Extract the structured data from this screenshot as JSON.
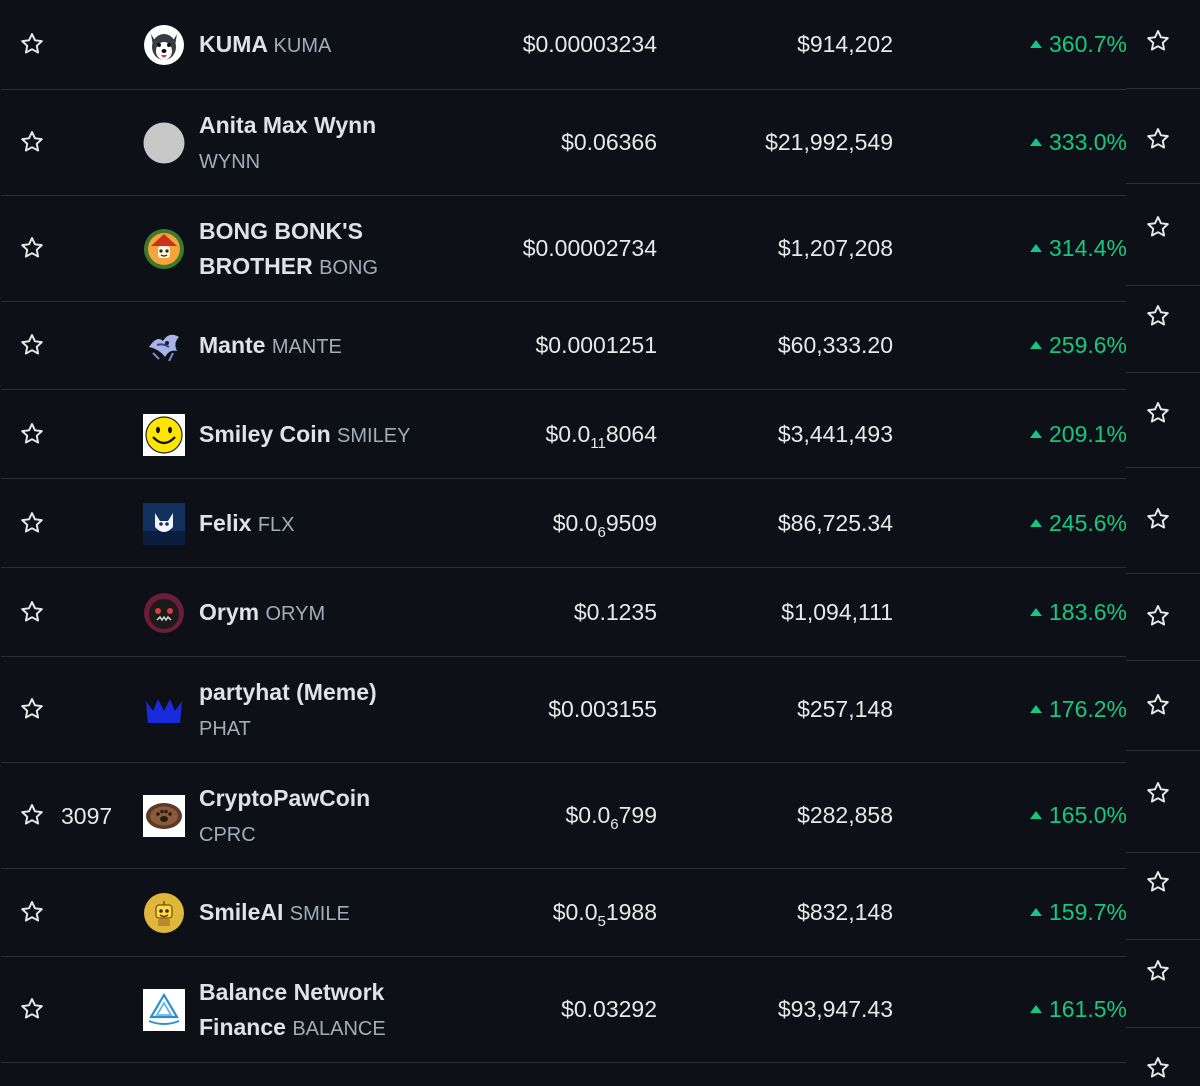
{
  "icons": {
    "favorite": "star-outline-icon",
    "trend": "caret-up-icon"
  },
  "colors": {
    "background": "#0d1117",
    "divider": "#2a2f37",
    "positive": "#16c784",
    "text": "#e6e8ea",
    "muted": "#a5acb8"
  },
  "rows": [
    {
      "rank": "",
      "name": "KUMA",
      "symbol": "KUMA",
      "symbol_inline": true,
      "price": "$0.00003234",
      "market_cap": "$914,202",
      "change": "360.7%",
      "logo": "husky-dog-logo"
    },
    {
      "rank": "",
      "name": "Anita Max Wynn",
      "symbol": "WYNN",
      "symbol_inline": false,
      "price": "$0.06366",
      "market_cap": "$21,992,549",
      "change": "333.0%",
      "logo": "grey-circle-logo"
    },
    {
      "rank": "",
      "name": "BONG BONK'S BROTHER",
      "symbol": "BONG",
      "symbol_inline": true,
      "price": "$0.00002734",
      "market_cap": "$1,207,208",
      "change": "314.4%",
      "logo": "bong-dog-logo"
    },
    {
      "rank": "",
      "name": "Mante",
      "symbol": "MANTE",
      "symbol_inline": true,
      "price": "$0.0001251",
      "market_cap": "$60,333.20",
      "change": "259.6%",
      "logo": "mante-creature-logo"
    },
    {
      "rank": "",
      "name": "Smiley Coin",
      "symbol": "SMILEY",
      "symbol_inline": true,
      "price_prefix": "$0.0",
      "price_sub": "11",
      "price_rest": "8064",
      "market_cap": "$3,441,493",
      "change": "209.1%",
      "logo": "smiley-face-logo"
    },
    {
      "rank": "",
      "name": "Felix",
      "symbol": "FLX",
      "symbol_inline": true,
      "price_prefix": "$0.0",
      "price_sub": "6",
      "price_rest": "9509",
      "market_cap": "$86,725.34",
      "change": "245.6%",
      "logo": "felix-cat-logo"
    },
    {
      "rank": "",
      "name": "Orym",
      "symbol": "ORYM",
      "symbol_inline": true,
      "price": "$0.1235",
      "market_cap": "$1,094,111",
      "change": "183.6%",
      "logo": "orym-dog-logo"
    },
    {
      "rank": "",
      "name": "partyhat (Meme)",
      "symbol": "PHAT",
      "symbol_inline": false,
      "price": "$0.003155",
      "market_cap": "$257,148",
      "change": "176.2%",
      "logo": "party-hat-logo"
    },
    {
      "rank": "3097",
      "name": "CryptoPawCoin",
      "symbol": "CPRC",
      "symbol_inline": false,
      "price_prefix": "$0.0",
      "price_sub": "6",
      "price_rest": "799",
      "market_cap": "$282,858",
      "change": "165.0%",
      "logo": "paw-coin-logo"
    },
    {
      "rank": "",
      "name": "SmileAI",
      "symbol": "SMILE",
      "symbol_inline": true,
      "price_prefix": "$0.0",
      "price_sub": "5",
      "price_rest": "1988",
      "market_cap": "$832,148",
      "change": "159.7%",
      "logo": "smile-ai-robot-logo"
    },
    {
      "rank": "",
      "name": "Balance Network Finance",
      "symbol": "BALANCE",
      "symbol_inline": true,
      "price": "$0.03292",
      "market_cap": "$93,947.43",
      "change": "161.5%",
      "logo": "balance-triangle-logo"
    }
  ]
}
